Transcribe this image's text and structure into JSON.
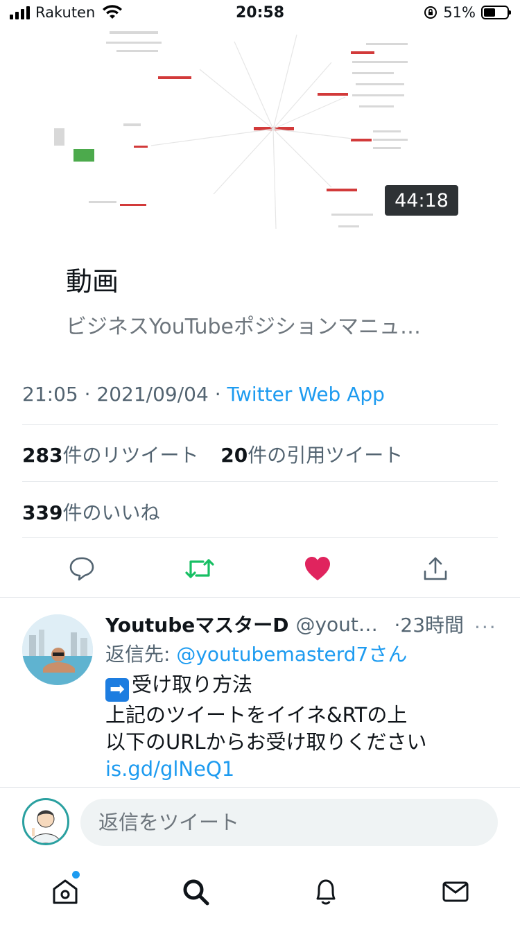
{
  "status_bar": {
    "carrier": "Rakuten",
    "time": "20:58",
    "battery_percent": "51%",
    "battery_level": 0.51
  },
  "media_card": {
    "duration": "44:18",
    "title": "動画",
    "description": "ビジネスYouTubeポジションマニュ…"
  },
  "tweet_meta": {
    "time": "21:05",
    "date": "2021/09/04",
    "separator": "·",
    "client": "Twitter Web App"
  },
  "stats": {
    "retweets_count": "283",
    "retweets_label": "件のリツイート",
    "quotes_count": "20",
    "quotes_label": "件の引用ツイート",
    "likes_count": "339",
    "likes_label": "件のいいね"
  },
  "actions": [
    "reply-icon",
    "retweet-icon",
    "like-icon",
    "share-icon"
  ],
  "colors": {
    "link": "#1d9bf0",
    "retweet": "#17bf63",
    "like": "#e0245e",
    "secondary_text": "#536471"
  },
  "reply": {
    "name": "YoutubeマスターD",
    "handle": "@youtu…",
    "time": "·23時間",
    "more": "···",
    "reply_to_label": "返信先: ",
    "reply_to_handle": "@youtubemasterd7さん",
    "line1": "受け取り方法",
    "line2": "上記のツイートをイイネ&RTの上",
    "line3": "以下のURLからお受け取りください",
    "link": "is.gd/glNeQ1"
  },
  "compose": {
    "placeholder": "返信をツイート"
  },
  "tab_bar": {
    "items": [
      "home-icon",
      "search-icon",
      "notifications-icon",
      "messages-icon"
    ],
    "home_has_badge": true
  }
}
